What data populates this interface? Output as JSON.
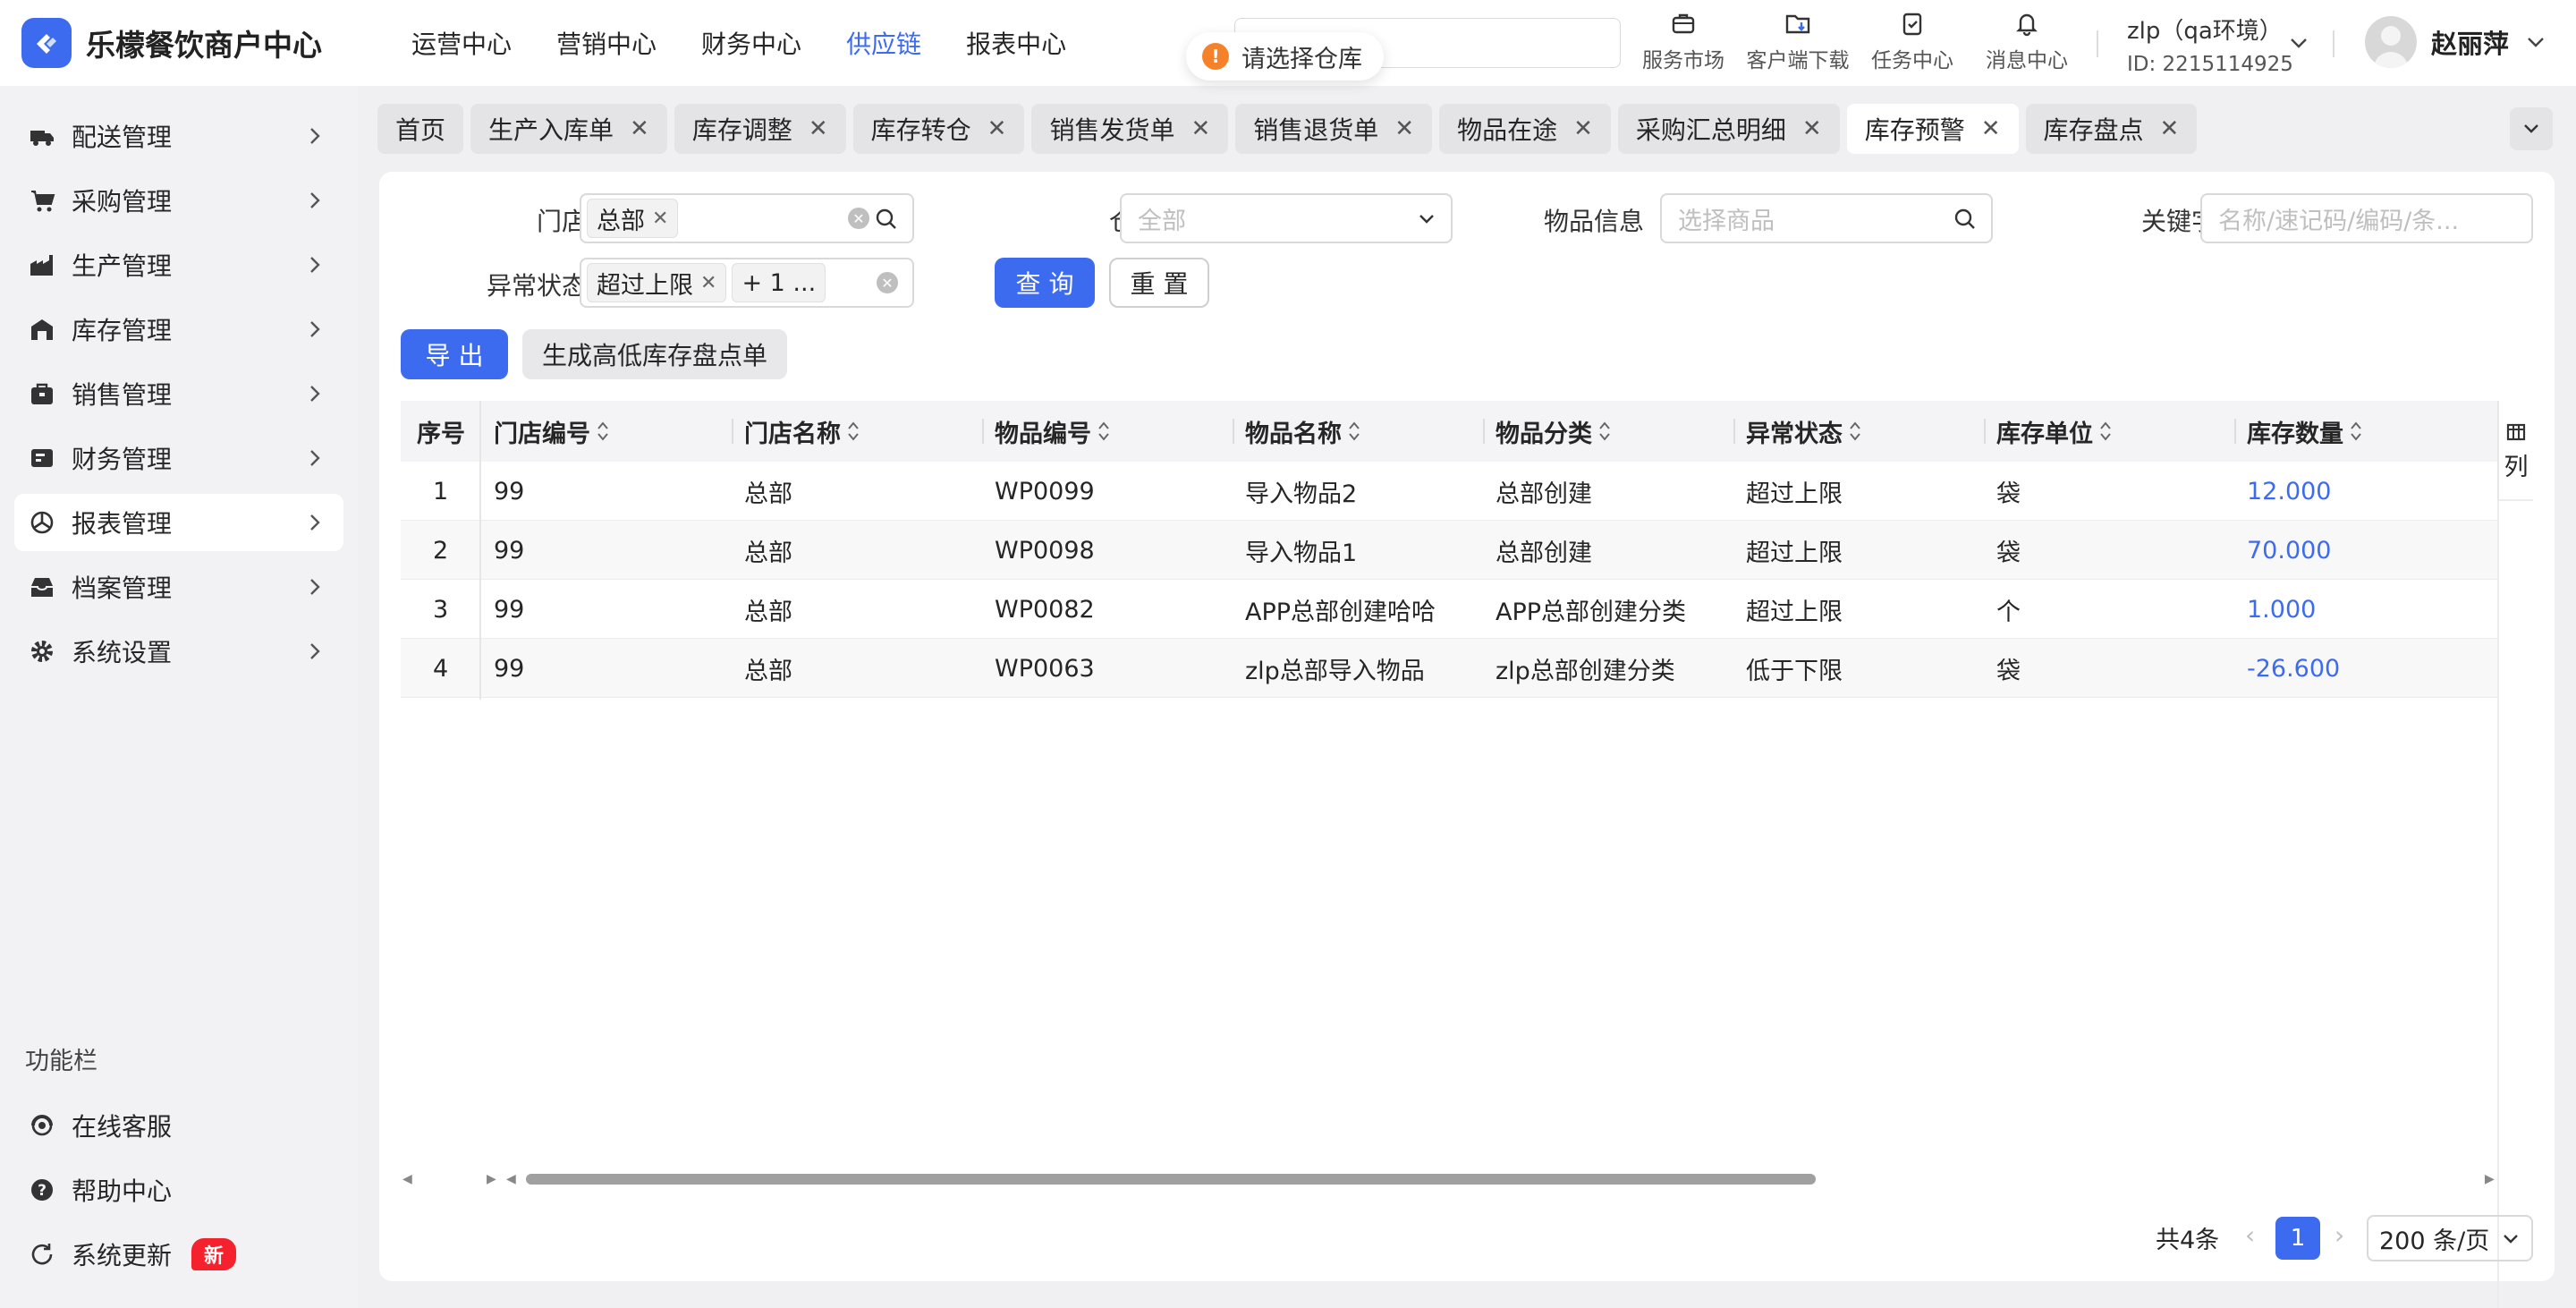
{
  "app": {
    "name": "乐檬餐饮商户中心"
  },
  "topnav": [
    {
      "label": "运营中心",
      "active": false
    },
    {
      "label": "营销中心",
      "active": false
    },
    {
      "label": "财务中心",
      "active": false
    },
    {
      "label": "供应链",
      "active": true
    },
    {
      "label": "报表中心",
      "active": false
    }
  ],
  "toast": {
    "icon": "!",
    "text": "请选择仓库"
  },
  "tools": [
    {
      "label": "服务市场",
      "icon": "briefcase-icon"
    },
    {
      "label": "客户端下载",
      "icon": "download-folder-icon"
    },
    {
      "label": "任务中心",
      "icon": "clipboard-check-icon"
    },
    {
      "label": "消息中心",
      "icon": "bell-icon"
    }
  ],
  "env": {
    "name": "zlp（qa环境）",
    "id": "ID: 2215114925"
  },
  "user": {
    "name": "赵丽萍"
  },
  "sidebar": {
    "items": [
      {
        "label": "配送管理",
        "icon": "truck-icon"
      },
      {
        "label": "采购管理",
        "icon": "cart-icon"
      },
      {
        "label": "生产管理",
        "icon": "factory-icon"
      },
      {
        "label": "库存管理",
        "icon": "warehouse-icon"
      },
      {
        "label": "销售管理",
        "icon": "bag-icon"
      },
      {
        "label": "财务管理",
        "icon": "wallet-icon"
      },
      {
        "label": "报表管理",
        "icon": "chart-icon"
      },
      {
        "label": "档案管理",
        "icon": "archive-icon"
      },
      {
        "label": "系统设置",
        "icon": "gear-icon"
      }
    ],
    "section_title": "功能栏",
    "bottom": [
      {
        "label": "在线客服",
        "icon": "headset-icon"
      },
      {
        "label": "帮助中心",
        "icon": "help-icon"
      },
      {
        "label": "系统更新",
        "icon": "refresh-icon",
        "badge": "新"
      }
    ]
  },
  "tabs": [
    {
      "label": "首页",
      "closable": false
    },
    {
      "label": "生产入库单",
      "closable": true
    },
    {
      "label": "库存调整",
      "closable": true
    },
    {
      "label": "库存转仓",
      "closable": true
    },
    {
      "label": "销售发货单",
      "closable": true
    },
    {
      "label": "销售退货单",
      "closable": true
    },
    {
      "label": "物品在途",
      "closable": true
    },
    {
      "label": "采购汇总明细",
      "closable": true
    },
    {
      "label": "库存预警",
      "closable": true,
      "active": true
    },
    {
      "label": "库存盘点",
      "closable": true
    }
  ],
  "filters": {
    "store_label": "门店",
    "store_tag": "总部",
    "warehouse_label": "仓库",
    "warehouse_placeholder": "全部",
    "item_label": "物品信息",
    "item_placeholder": "选择商品",
    "keyword_label": "关键字",
    "keyword_placeholder": "名称/速记码/编码/条...",
    "status_label": "异常状态",
    "status_tag": "超过上限",
    "status_more": "+ 1 ...",
    "query_btn": "查 询",
    "reset_btn": "重 置"
  },
  "actions": {
    "export_btn": "导 出",
    "generate_btn": "生成高低库存盘点单"
  },
  "table": {
    "columns": [
      "序号",
      "门店编号",
      "门店名称",
      "物品编号",
      "物品名称",
      "物品分类",
      "异常状态",
      "库存单位",
      "库存数量"
    ],
    "rows": [
      [
        "1",
        "99",
        "总部",
        "WP0099",
        "导入物品2",
        "总部创建",
        "超过上限",
        "袋",
        "12.000"
      ],
      [
        "2",
        "99",
        "总部",
        "WP0098",
        "导入物品1",
        "总部创建",
        "超过上限",
        "袋",
        "70.000"
      ],
      [
        "3",
        "99",
        "总部",
        "WP0082",
        "APP总部创建哈哈",
        "APP总部创建分类",
        "超过上限",
        "个",
        "1.000"
      ],
      [
        "4",
        "99",
        "总部",
        "WP0063",
        "zlp总部导入物品",
        "zlp总部创建分类",
        "低于下限",
        "袋",
        "-26.600"
      ]
    ],
    "column_setting": "列"
  },
  "pagination": {
    "total": "共4条",
    "current": "1",
    "page_size": "200 条/页"
  },
  "colors": {
    "primary": "#3d6bf0",
    "warning": "#f5822a",
    "badge": "#f5222d"
  }
}
